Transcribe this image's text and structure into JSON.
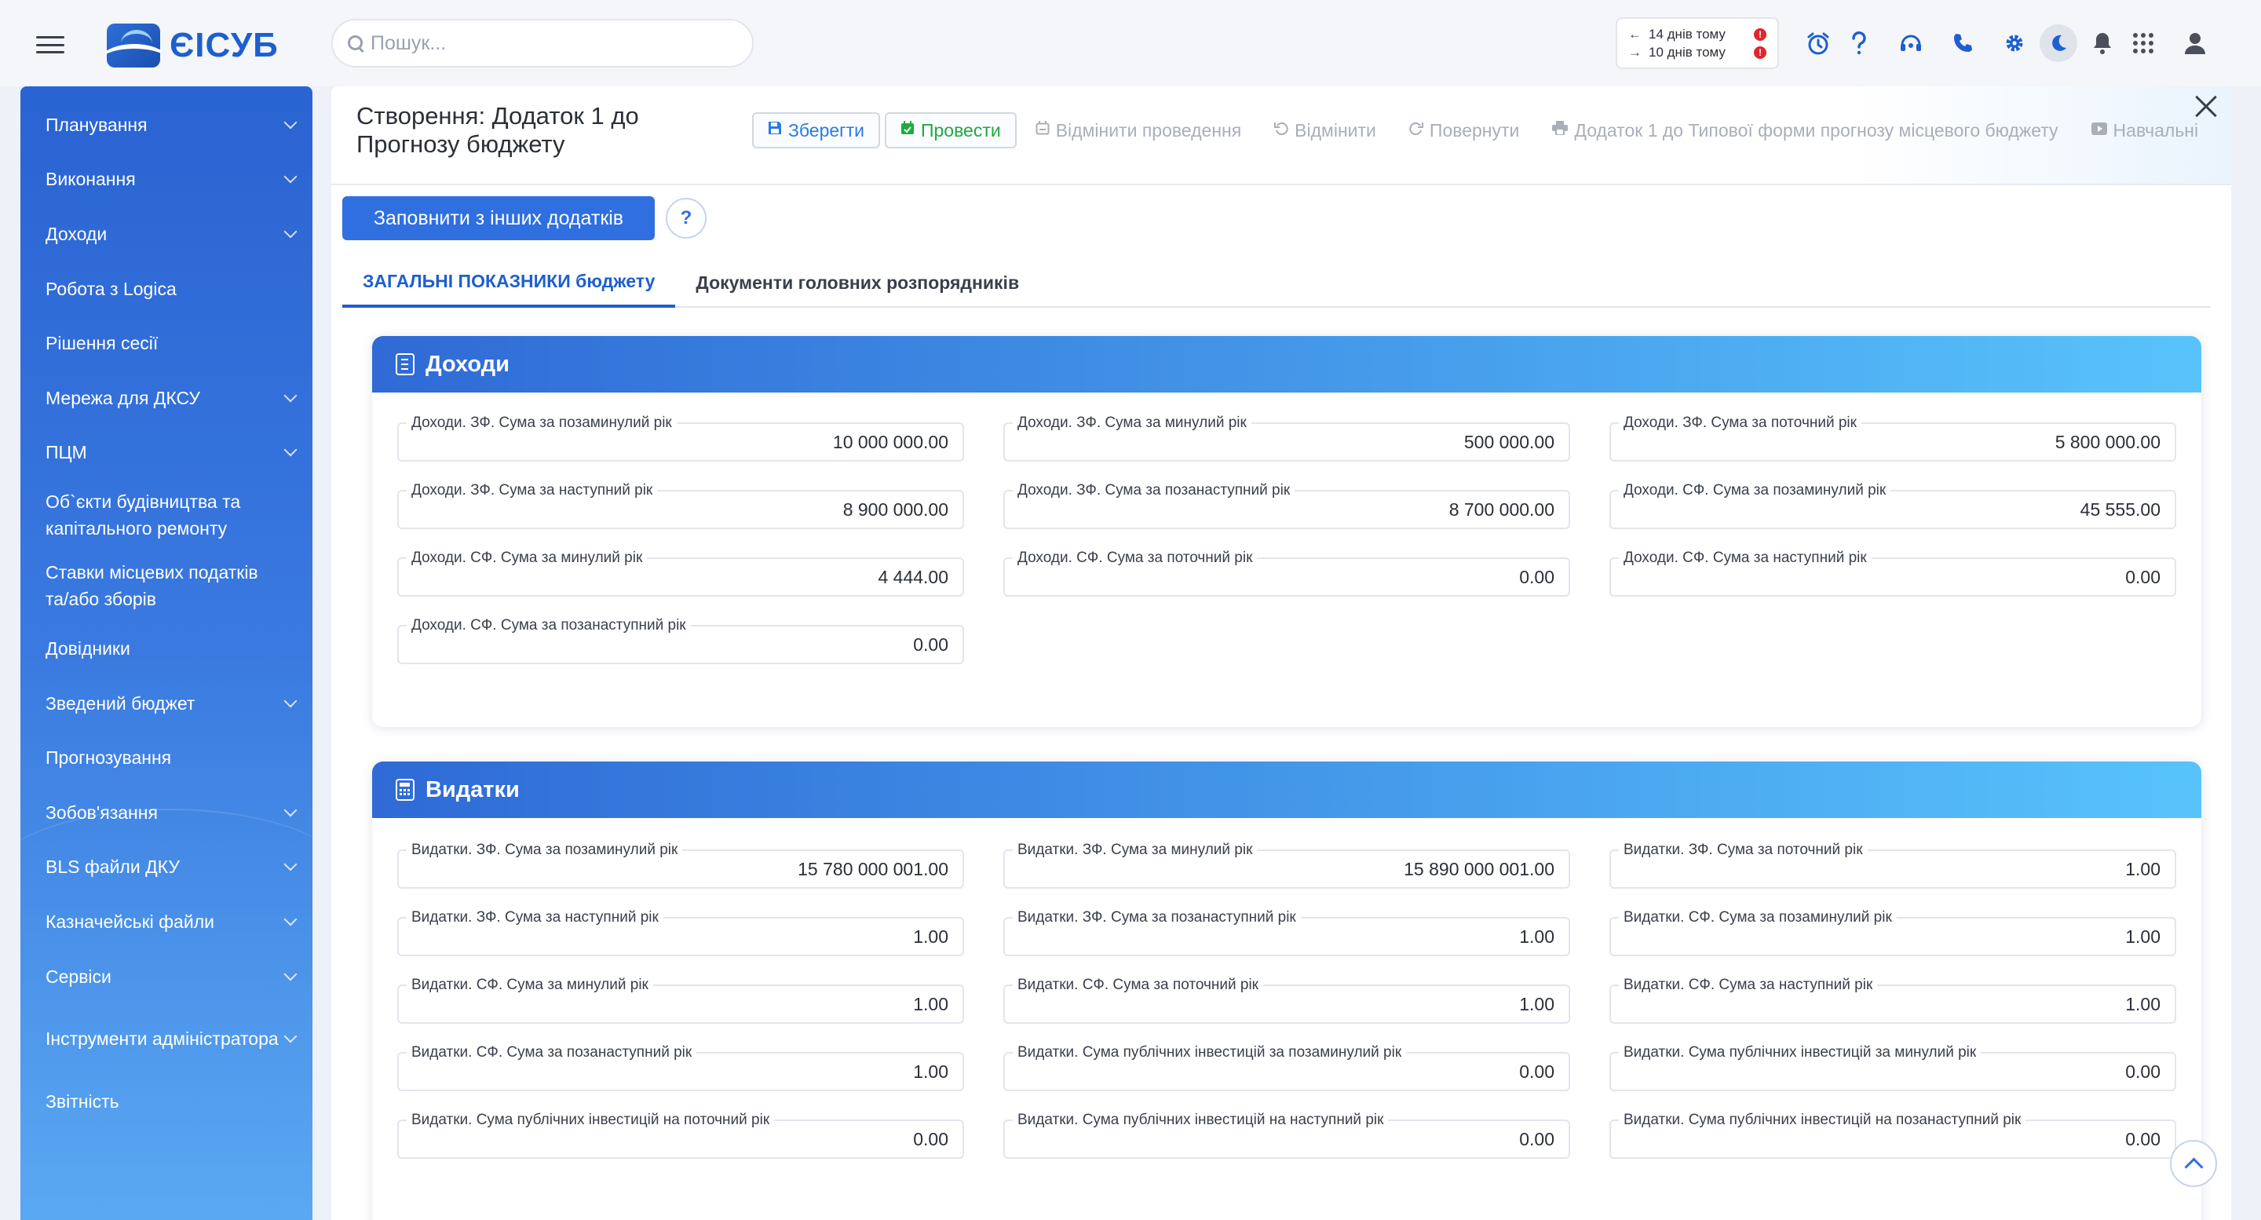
{
  "app": {
    "logo_text": "ЄІСУБ"
  },
  "search": {
    "placeholder": "Пошук..."
  },
  "history": {
    "back": "14 днів тому",
    "forward": "10 днів тому",
    "badge": "!"
  },
  "top_icons": [
    "alarm-clock-icon",
    "help-icon",
    "headset-icon",
    "phone-icon",
    "gear-icon",
    "moon-icon",
    "bell-icon",
    "apps-grid-icon",
    "user-icon"
  ],
  "sidebar": {
    "items": [
      {
        "label": "Планування",
        "expandable": true
      },
      {
        "label": "Виконання",
        "expandable": true
      },
      {
        "label": "Доходи",
        "expandable": true
      },
      {
        "label": "Робота з Logica",
        "expandable": false
      },
      {
        "label": "Рішення сесії",
        "expandable": false
      },
      {
        "label": "Мережа для ДКСУ",
        "expandable": true
      },
      {
        "label": "ПЦМ",
        "expandable": true
      },
      {
        "label": "Об`єкти будівництва та капітального ремонту",
        "expandable": false
      },
      {
        "label": "Ставки місцевих податків та/або зборів",
        "expandable": false
      },
      {
        "label": "Довідники",
        "expandable": false
      },
      {
        "label": "Зведений бюджет",
        "expandable": true
      },
      {
        "label": "Прогнозування",
        "expandable": false
      },
      {
        "label": "Зобов'язання",
        "expandable": true
      },
      {
        "label": "BLS файли ДКУ",
        "expandable": true
      },
      {
        "label": "Казначейські файли",
        "expandable": true
      },
      {
        "label": "Сервіси",
        "expandable": true
      },
      {
        "label": "Інструменти адміністратора",
        "expandable": true
      },
      {
        "label": "Звітність",
        "expandable": false
      }
    ]
  },
  "document": {
    "title": "Створення: Додаток 1 до Прогнозу бюджету"
  },
  "toolbar": {
    "save": "Зберегти",
    "post": "Провести",
    "unpost": "Відмінити проведення",
    "cancel": "Відмінити",
    "restore": "Повернути",
    "print": "Додаток 1 до Типової форми прогнозу місцевого бюджету",
    "training": "Навчальні"
  },
  "actions": {
    "fill_from_other": "Заповнити з інших додатків",
    "help": "?"
  },
  "tabs": [
    {
      "label": "ЗАГАЛЬНІ ПОКАЗНИКИ бюджету",
      "active": true
    },
    {
      "label": "Документи головних розпорядників",
      "active": false
    }
  ],
  "income": {
    "title": "Доходи",
    "fields": [
      {
        "label": "Доходи. ЗФ. Сума за позаминулий рік",
        "value": "10 000 000.00"
      },
      {
        "label": "Доходи. ЗФ. Сума за минулий рік",
        "value": "500 000.00"
      },
      {
        "label": "Доходи. ЗФ. Сума за поточний рік",
        "value": "5 800 000.00"
      },
      {
        "label": "Доходи. ЗФ. Сума за наступний рік",
        "value": "8 900 000.00"
      },
      {
        "label": "Доходи. ЗФ. Сума за позанаступний рік",
        "value": "8 700 000.00"
      },
      {
        "label": "Доходи. СФ. Сума за позаминулий рік",
        "value": "45 555.00"
      },
      {
        "label": "Доходи. СФ. Сума за минулий рік",
        "value": "4 444.00"
      },
      {
        "label": "Доходи. СФ. Сума за поточний рік",
        "value": "0.00"
      },
      {
        "label": "Доходи. СФ. Сума за наступний рік",
        "value": "0.00"
      },
      {
        "label": "Доходи. СФ. Сума за позанаступний рік",
        "value": "0.00"
      }
    ]
  },
  "expenses": {
    "title": "Видатки",
    "fields": [
      {
        "label": "Видатки. ЗФ. Сума за позаминулий рік",
        "value": "15 780 000 001.00"
      },
      {
        "label": "Видатки. ЗФ. Сума за минулий рік",
        "value": "15 890 000 001.00"
      },
      {
        "label": "Видатки. ЗФ. Сума за поточний рік",
        "value": "1.00"
      },
      {
        "label": "Видатки. ЗФ. Сума за наступний рік",
        "value": "1.00"
      },
      {
        "label": "Видатки. ЗФ. Сума за позанаступний рік",
        "value": "1.00"
      },
      {
        "label": "Видатки. СФ. Сума за позаминулий рік",
        "value": "1.00"
      },
      {
        "label": "Видатки. СФ. Сума за минулий рік",
        "value": "1.00"
      },
      {
        "label": "Видатки. СФ. Сума за поточний рік",
        "value": "1.00"
      },
      {
        "label": "Видатки. СФ. Сума за наступний рік",
        "value": "1.00"
      },
      {
        "label": "Видатки. СФ. Сума за позанаступний рік",
        "value": "1.00"
      },
      {
        "label": "Видатки. Сума публічних інвестицій за позаминулий рік",
        "value": "0.00"
      },
      {
        "label": "Видатки. Сума публічних інвестицій за минулий рік",
        "value": "0.00"
      },
      {
        "label": "Видатки. Сума публічних інвестицій на поточний рік",
        "value": "0.00"
      },
      {
        "label": "Видатки. Сума публічних інвестицій на наступний рік",
        "value": "0.00"
      },
      {
        "label": "Видатки. Сума публічних інвестицій на позанаступний рік",
        "value": "0.00"
      }
    ]
  }
}
